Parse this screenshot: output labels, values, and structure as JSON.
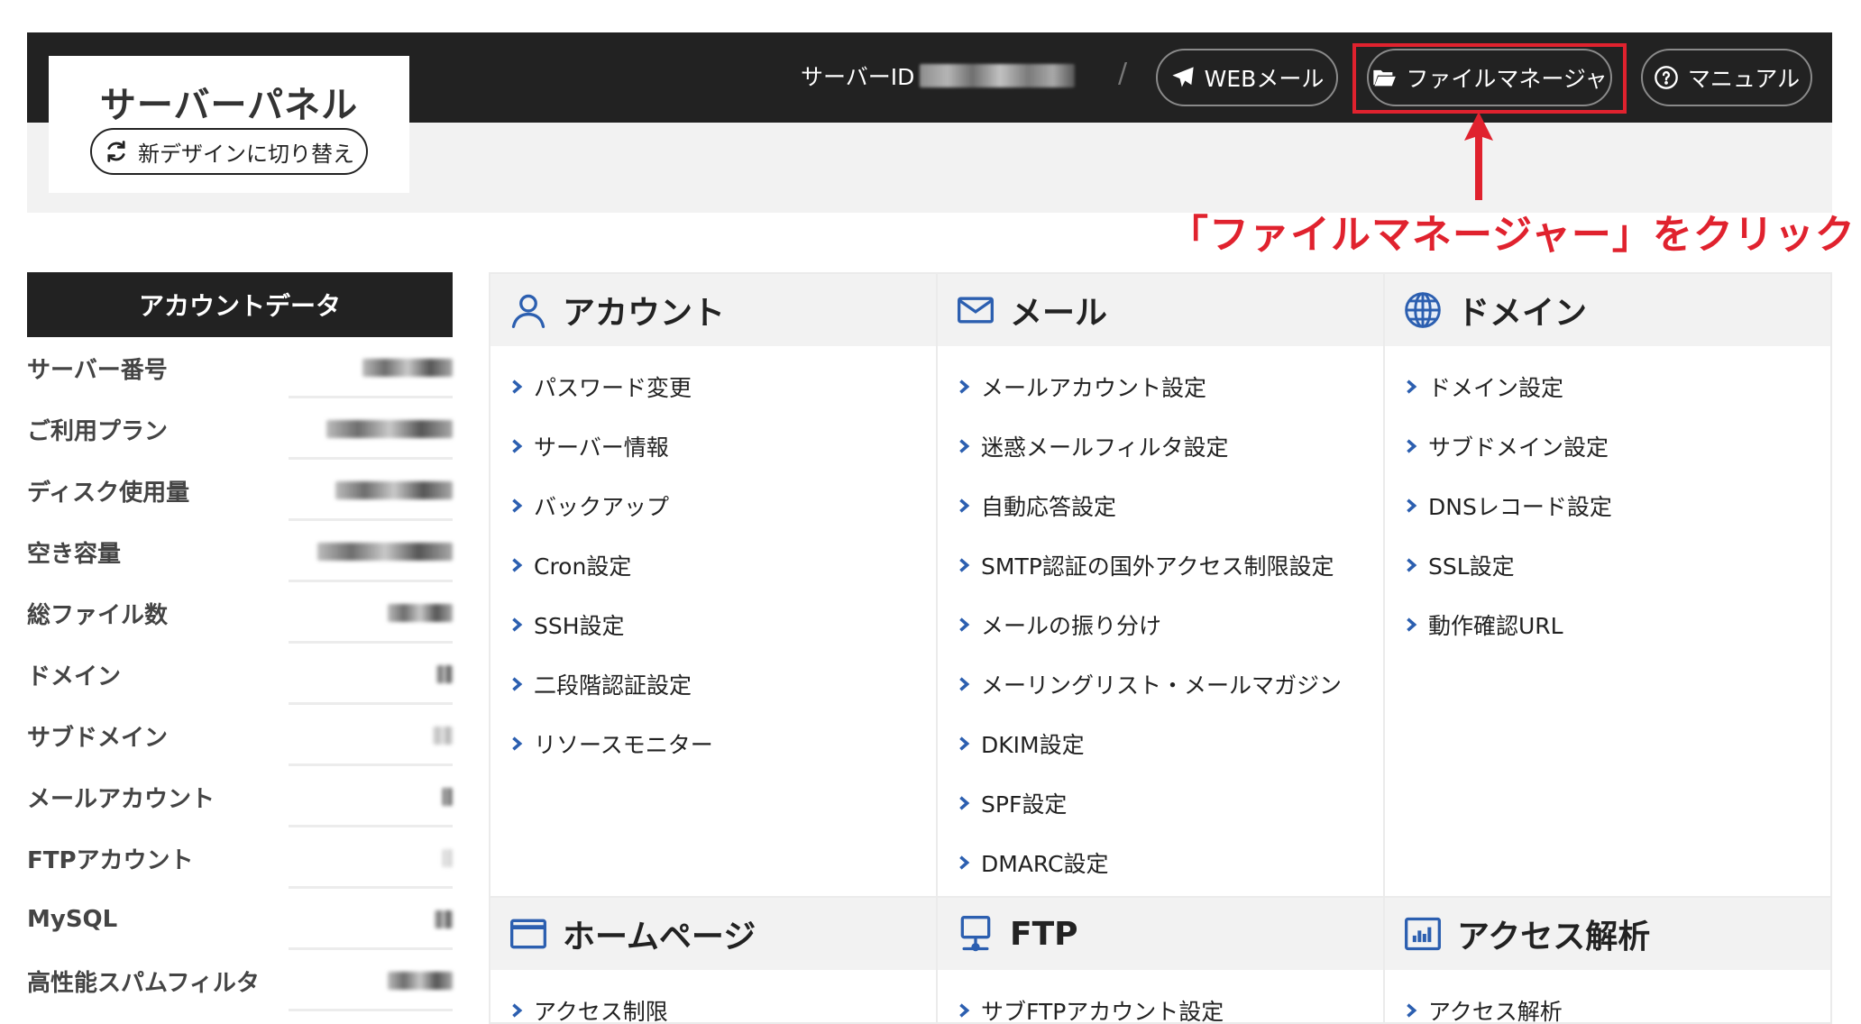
{
  "header": {
    "logo_title": "サーバーパネル",
    "design_switch_label": "新デザインに切り替え",
    "server_id_label": "サーバーID",
    "separator": "/",
    "buttons": {
      "web_mail": "WEBメール",
      "file_manager": "ファイルマネージャ",
      "manual": "マニュアル"
    },
    "icons": {
      "web_mail": "paper-plane-icon",
      "file_manager": "folder-open-icon",
      "manual": "question-circle-icon",
      "design_switch": "sync-icon"
    }
  },
  "annotation": {
    "callout_text": "「ファイルマネージャー」をクリック",
    "color": "#e0222e"
  },
  "sidebar": {
    "title": "アカウントデータ",
    "rows": [
      {
        "label": "サーバー番号"
      },
      {
        "label": "ご利用プラン"
      },
      {
        "label": "ディスク使用量"
      },
      {
        "label": "空き容量"
      },
      {
        "label": "総ファイル数"
      },
      {
        "label": "ドメイン"
      },
      {
        "label": "サブドメイン"
      },
      {
        "label": "メールアカウント"
      },
      {
        "label": "FTPアカウント"
      },
      {
        "label": "MySQL"
      },
      {
        "label": "高性能スパムフィルタ"
      }
    ]
  },
  "sections": {
    "account": {
      "title": "アカウント",
      "icon": "user-icon",
      "items": [
        "パスワード変更",
        "サーバー情報",
        "バックアップ",
        "Cron設定",
        "SSH設定",
        "二段階認証設定",
        "リソースモニター"
      ]
    },
    "mail": {
      "title": "メール",
      "icon": "envelope-icon",
      "items": [
        "メールアカウント設定",
        "迷惑メールフィルタ設定",
        "自動応答設定",
        "SMTP認証の国外アクセス制限設定",
        "メールの振り分け",
        "メーリングリスト・メールマガジン",
        "DKIM設定",
        "SPF設定",
        "DMARC設定"
      ]
    },
    "domain": {
      "title": "ドメイン",
      "icon": "globe-icon",
      "items": [
        "ドメイン設定",
        "サブドメイン設定",
        "DNSレコード設定",
        "SSL設定",
        "動作確認URL"
      ]
    },
    "homepage": {
      "title": "ホームページ",
      "icon": "browser-window-icon",
      "items": [
        "アクセス制限"
      ]
    },
    "ftp": {
      "title": "FTP",
      "icon": "monitor-icon",
      "items": [
        "サブFTPアカウント設定"
      ]
    },
    "analytics": {
      "title": "アクセス解析",
      "icon": "bar-chart-icon",
      "items": [
        "アクセス解析"
      ]
    }
  },
  "colors": {
    "header_bg": "#222222",
    "subbar_bg": "#f2f2f2",
    "accent_blue": "#2c5fb0",
    "highlight_red": "#e0222e"
  }
}
